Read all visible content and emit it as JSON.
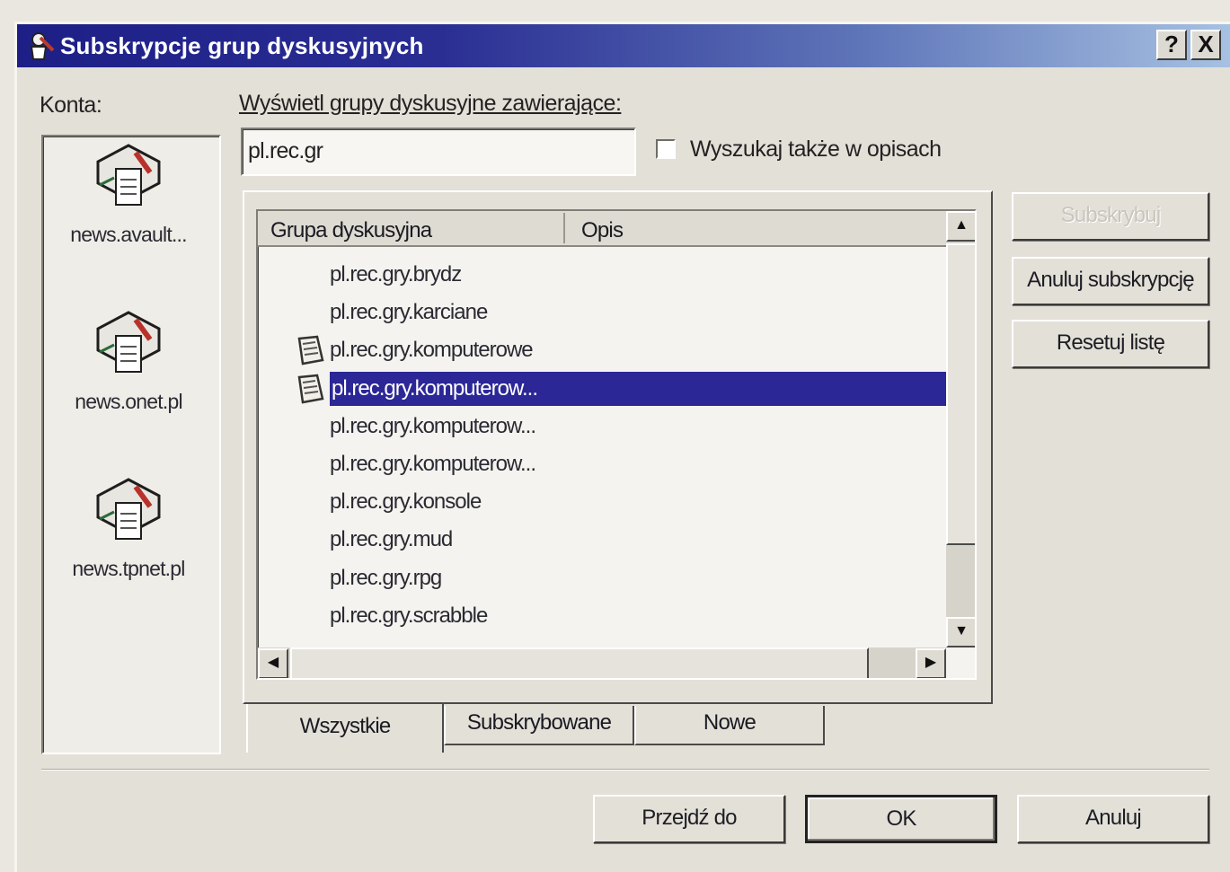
{
  "window": {
    "title": "Subskrypcje grup dyskusyjnych",
    "help_btn": "?",
    "close_btn": "X"
  },
  "accounts": {
    "label": "Konta:",
    "items": [
      "news.avault...",
      "news.onet.pl",
      "news.tpnet.pl"
    ]
  },
  "search": {
    "label": "Wyświetl grupy dyskusyjne zawierające:",
    "value": "pl.rec.gr",
    "checkbox_label": "Wyszukaj także w opisach",
    "checkbox_checked": false
  },
  "list": {
    "columns": [
      "Grupa dyskusyjna",
      "Opis"
    ],
    "rows": [
      {
        "name": "pl.rec.gry.brydz",
        "subscribed": false,
        "selected": false
      },
      {
        "name": "pl.rec.gry.karciane",
        "subscribed": false,
        "selected": false
      },
      {
        "name": "pl.rec.gry.komputerowe",
        "subscribed": true,
        "selected": false
      },
      {
        "name": "pl.rec.gry.komputerow...",
        "subscribed": true,
        "selected": true
      },
      {
        "name": "pl.rec.gry.komputerow...",
        "subscribed": false,
        "selected": false
      },
      {
        "name": "pl.rec.gry.komputerow...",
        "subscribed": false,
        "selected": false
      },
      {
        "name": "pl.rec.gry.konsole",
        "subscribed": false,
        "selected": false
      },
      {
        "name": "pl.rec.gry.mud",
        "subscribed": false,
        "selected": false
      },
      {
        "name": "pl.rec.gry.rpg",
        "subscribed": false,
        "selected": false
      },
      {
        "name": "pl.rec.gry.scrabble",
        "subscribed": false,
        "selected": false
      }
    ]
  },
  "tabs": [
    "Wszystkie",
    "Subskrybowane",
    "Nowe"
  ],
  "side_buttons": {
    "subscribe": "Subskrybuj",
    "unsubscribe": "Anuluj subskrypcję",
    "reset": "Resetuj listę"
  },
  "bottom_buttons": {
    "goto": "Przejdź do",
    "ok": "OK",
    "cancel": "Anuluj"
  },
  "colors": {
    "title_start": "#1d1f86",
    "title_end": "#a6c1e2",
    "selection": "#2b2797",
    "face": "#e3e0d8"
  }
}
